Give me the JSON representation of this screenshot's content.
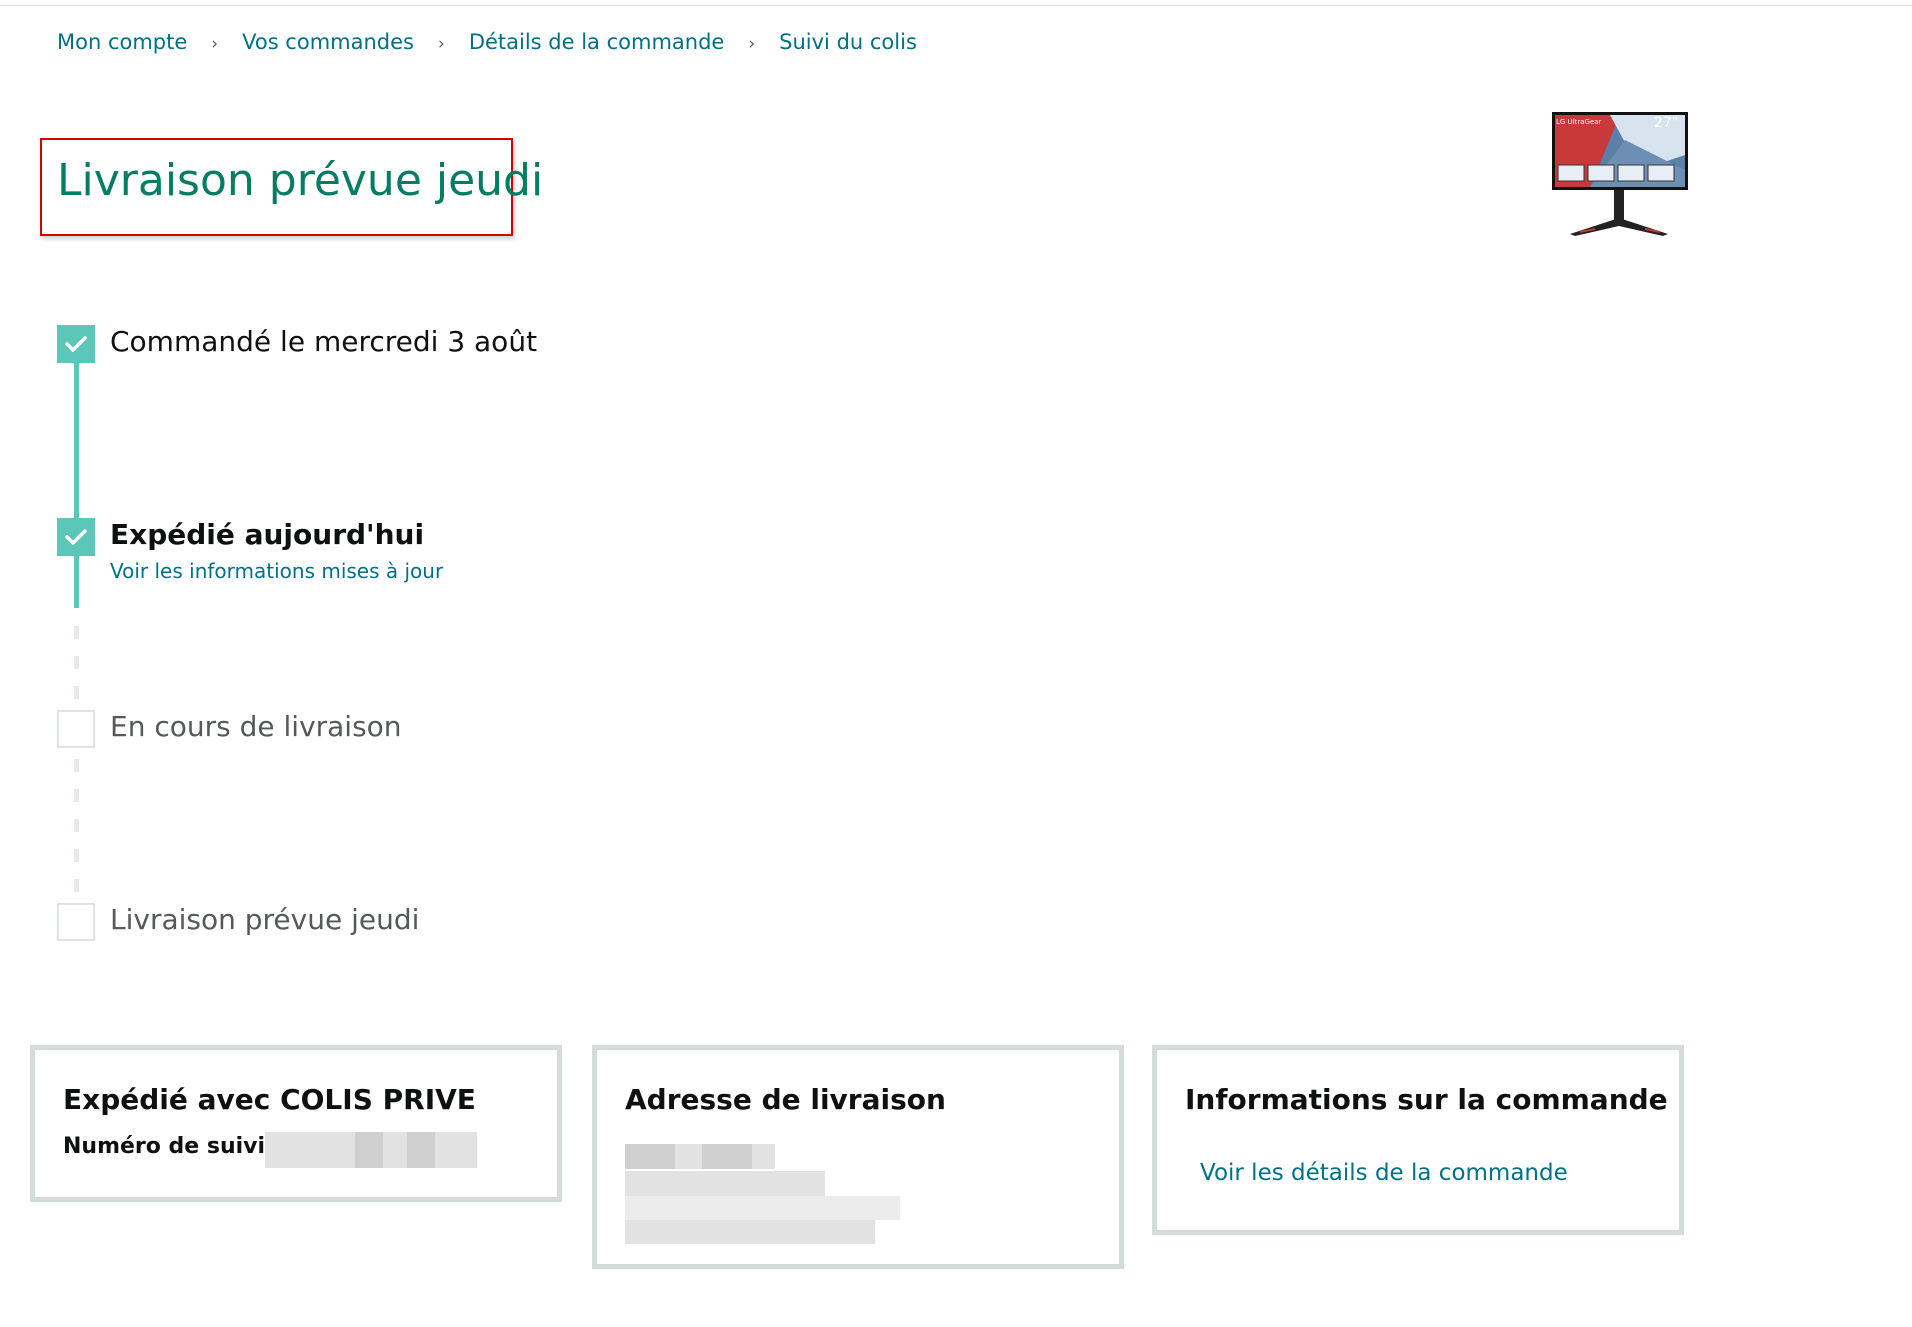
{
  "breadcrumb": {
    "items": [
      "Mon compte",
      "Vos commandes",
      "Détails de la commande",
      "Suivi du colis"
    ],
    "separator": "›"
  },
  "header": {
    "title": "Livraison prévue jeudi",
    "product_image_text": "27\"",
    "product_brand_text": "LG UltraGear"
  },
  "tracker": {
    "steps": [
      {
        "label": "Commandé le mercredi 3 août",
        "done": true
      },
      {
        "label": "Expédié aujourd'hui",
        "done": true,
        "link": "Voir les informations mises à jour"
      },
      {
        "label": "En cours de livraison",
        "done": false
      },
      {
        "label": "Livraison prévue jeudi",
        "done": false
      }
    ]
  },
  "cards": {
    "shipping": {
      "title": "Expédié avec COLIS PRIVE",
      "tracking_label": "Numéro de suivi : 5"
    },
    "address": {
      "title": "Adresse de livraison"
    },
    "order_info": {
      "title": "Informations sur la commande",
      "link": "Voir les détails de la commande"
    }
  },
  "colors": {
    "link": "#007185",
    "title": "#067D62",
    "progress": "#5CC7B8",
    "highlight_border": "#d40000",
    "card_border": "#d5dbdb"
  },
  "icons": [
    "check-icon"
  ]
}
